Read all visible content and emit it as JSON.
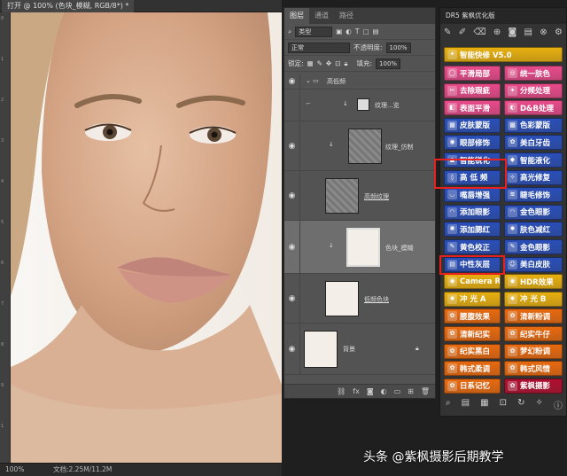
{
  "document_tab": {
    "title": "打开 @ 100% (色块_模糊, RGB/8*) *"
  },
  "statusbar": {
    "zoom": "100%",
    "doc_info": "文档:2.25M/11.2M"
  },
  "ruler": {
    "marks": [
      "0",
      "1",
      "2",
      "3",
      "4",
      "5",
      "6",
      "7",
      "8",
      "9",
      "1",
      "0"
    ]
  },
  "layers_panel": {
    "tabs": [
      "图层",
      "通道",
      "路径"
    ],
    "filter_label": "类型",
    "blend_mode": "正常",
    "opacity_label": "不透明度:",
    "opacity_value": "100%",
    "lock_label": "锁定:",
    "fill_label": "填充:",
    "fill_value": "100%",
    "layers": [
      {
        "name": "高低频",
        "kind": "group"
      },
      {
        "name": "纹理...览",
        "kind": "adjust"
      },
      {
        "name": "纹理_仿制",
        "kind": "layer"
      },
      {
        "name": "高频纹理",
        "kind": "layer"
      },
      {
        "name": "色块_模糊",
        "kind": "layer"
      },
      {
        "name": "低频色块",
        "kind": "layer"
      },
      {
        "name": "背景",
        "kind": "layer"
      }
    ],
    "footer_icons": [
      "link-icon",
      "fx-icon",
      "mask-icon",
      "adjustment-icon",
      "folder-icon",
      "new-layer-icon",
      "trash-icon"
    ]
  },
  "dr5_panel": {
    "title": "DR5 紫枫优化版",
    "buttons": [
      {
        "label": "智能快修 V5.0",
        "color": "#e8b010"
      },
      {
        "label": "平滑局部",
        "color": "#e84b8a"
      },
      {
        "label": "统一肤色",
        "color": "#e84b8a"
      },
      {
        "label": "去除瑕疵",
        "color": "#e84b8a"
      },
      {
        "label": "分频处理",
        "color": "#e84b8a"
      },
      {
        "label": "表面平滑",
        "color": "#e84b8a"
      },
      {
        "label": "D&B处理",
        "color": "#e84b8a"
      },
      {
        "label": "皮肤蒙版",
        "color": "#2a4fb8"
      },
      {
        "label": "色彩蒙版",
        "color": "#2a4fb8"
      },
      {
        "label": "眼部修饰",
        "color": "#2a4fb8"
      },
      {
        "label": "美白牙齿",
        "color": "#2a4fb8"
      },
      {
        "label": "智能锐化",
        "color": "#2a4fb8"
      },
      {
        "label": "智能液化",
        "color": "#2a4fb8"
      },
      {
        "label": "高 低 频",
        "color": "#2a4fb8"
      },
      {
        "label": "高光修复",
        "color": "#2a4fb8"
      },
      {
        "label": "嘴唇增强",
        "color": "#2a4fb8"
      },
      {
        "label": "睫毛修饰",
        "color": "#2a4fb8"
      },
      {
        "label": "添加眼影",
        "color": "#2a4fb8"
      },
      {
        "label": "金色眼影",
        "color": "#2a4fb8"
      },
      {
        "label": "添加腮红",
        "color": "#2a4fb8"
      },
      {
        "label": "肤色减红",
        "color": "#2a4fb8"
      },
      {
        "label": "黄色校正",
        "color": "#2a4fb8"
      },
      {
        "label": "金色眼影",
        "color": "#2a4fb8"
      },
      {
        "label": "中性灰层",
        "color": "#2a4fb8"
      },
      {
        "label": "美白皮肤",
        "color": "#2a4fb8"
      },
      {
        "label": "Camera Raw",
        "color": "#e8b010"
      },
      {
        "label": "HDR效果",
        "color": "#e8b010"
      },
      {
        "label": "冲 光 A",
        "color": "#e8b010"
      },
      {
        "label": "冲 光 B",
        "color": "#e8b010"
      },
      {
        "label": "腰腹效果",
        "color": "#e86a10"
      },
      {
        "label": "清新粉调",
        "color": "#e86a10"
      },
      {
        "label": "清新纪实",
        "color": "#e86a10"
      },
      {
        "label": "纪实牛仔",
        "color": "#e86a10"
      },
      {
        "label": "纪实黑白",
        "color": "#e86a10"
      },
      {
        "label": "梦幻粉调",
        "color": "#e86a10"
      },
      {
        "label": "韩式柔调",
        "color": "#e86a10"
      },
      {
        "label": "韩式风情",
        "color": "#e86a10"
      },
      {
        "label": "日系记忆",
        "color": "#e86a10"
      },
      {
        "label": "紫枫摄影",
        "color": "#b01030"
      }
    ]
  },
  "watermark": "头条 @紫枫摄影后期教学"
}
